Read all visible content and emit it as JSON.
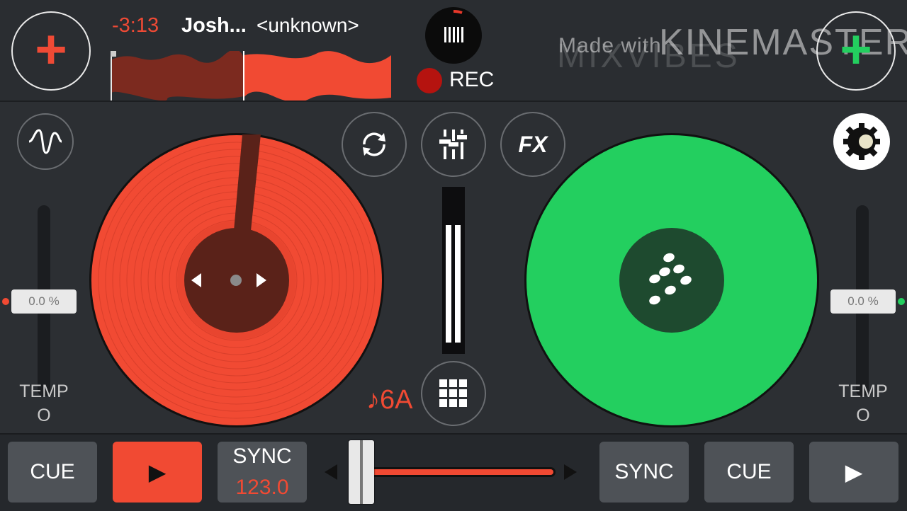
{
  "header": {
    "left_add_label": "+",
    "right_add_label": "+",
    "time_remaining": "-3:13",
    "artist": "Josh...",
    "track_title": "<unknown>",
    "rec_label": "REC",
    "watermark_made_with": "Made with",
    "watermark_kinemaster": "KINEMASTER",
    "watermark_mixvibes": "MIXVIBES"
  },
  "deck_left": {
    "tempo_value": "0.0 %",
    "tempo_label": "TEMP",
    "tempo_sub": "O",
    "key": "♪6A",
    "color": "#f14a33"
  },
  "deck_right": {
    "tempo_value": "0.0 %",
    "tempo_label": "TEMP",
    "tempo_sub": "O",
    "color": "#23cf5f"
  },
  "center": {
    "fx_label": "FX"
  },
  "bottom": {
    "left_cue_label": "CUE",
    "left_play_label": "▶",
    "left_sync_label": "SYNC",
    "left_bpm": "123.0",
    "right_sync_label": "SYNC",
    "right_cue_label": "CUE",
    "right_play_label": "▶",
    "crossfader_level": 0.04
  },
  "icons": [
    "plus-icon",
    "waveform-icon",
    "loop-icon",
    "mixer-icon",
    "gear-icon",
    "grid-icon",
    "rec-icon"
  ]
}
